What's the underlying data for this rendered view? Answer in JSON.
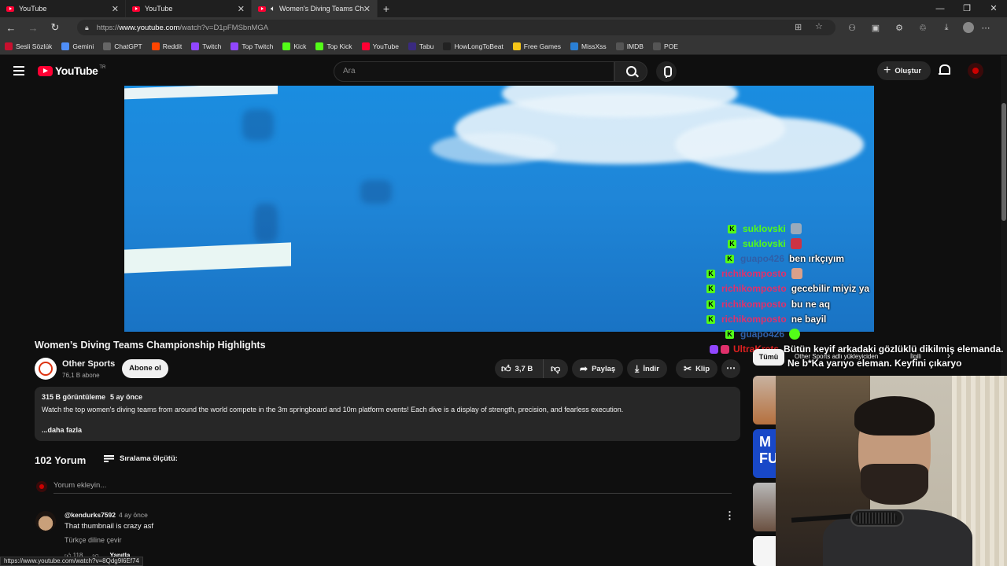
{
  "browser": {
    "tabs": [
      {
        "title": "YouTube",
        "active": false
      },
      {
        "title": "YouTube",
        "active": false
      },
      {
        "title": "Women's Diving Teams Cha",
        "active": true
      }
    ],
    "window_controls": {
      "minimize": "—",
      "maximize": "❐",
      "close": "✕"
    },
    "address": {
      "prefix": "https://",
      "host": "www.youtube.com",
      "path": "/watch?v=D1pFMSbnMGA"
    },
    "bookmarks": [
      {
        "label": "Sesli Sözlük",
        "color": "#c8102e"
      },
      {
        "label": "Gemini",
        "color": "#4f8ef7"
      },
      {
        "label": "ChatGPT",
        "color": "#666666"
      },
      {
        "label": "Reddit",
        "color": "#ff4500"
      },
      {
        "label": "Twitch",
        "color": "#9146ff"
      },
      {
        "label": "Top Twitch",
        "color": "#9146ff"
      },
      {
        "label": "Kick",
        "color": "#53fc18"
      },
      {
        "label": "Top Kick",
        "color": "#53fc18"
      },
      {
        "label": "YouTube",
        "color": "#ff0033"
      },
      {
        "label": "Tabu",
        "color": "#3a2a80"
      },
      {
        "label": "HowLongToBeat",
        "color": "#222222"
      },
      {
        "label": "Free Games",
        "color": "#f5c518"
      },
      {
        "label": "MissXss",
        "color": "#2a7fd4"
      },
      {
        "label": "IMDB",
        "color": "#555555"
      },
      {
        "label": "POE",
        "color": "#555555"
      }
    ],
    "status_url": "https://www.youtube.com/watch?v=8Qdg9l6Ef74"
  },
  "youtube": {
    "logo": "YouTube",
    "region": "TR",
    "search_placeholder": "Ara",
    "create_label": "Oluştur"
  },
  "video": {
    "title": "Women’s Diving Teams Championship Highlights",
    "channel": "Other Sports",
    "subscribers": "76,1 B abone",
    "subscribe_label": "Abone ol",
    "likes": "3,7 B",
    "share_label": "Paylaş",
    "download_label": "İndir",
    "clip_label": "Klip",
    "views": "315 B görüntüleme",
    "age": "5 ay önce",
    "description": "Watch the top women's diving teams from around the world compete in the 3m springboard and 10m platform events! Each dive is a display of strength, precision, and fearless execution.",
    "more_label": "...daha fazla"
  },
  "comments": {
    "count": "102 Yorum",
    "sort_label": "Sıralama ölçütü:",
    "add_placeholder": "Yorum ekleyin...",
    "items": [
      {
        "author": "@kendurks7592",
        "age": "4 ay önce",
        "text": "That thumbnail is crazy asf",
        "translate": "Türkçe diline çevir",
        "likes": "118",
        "reply_label": "Yanıtla"
      }
    ]
  },
  "sidebar": {
    "chips": [
      "Tümü",
      "Other Sports adlı yükleyiciden",
      "İlgili"
    ]
  },
  "chat_overlay": [
    {
      "user": "suklovski",
      "msg": "",
      "color": "#53fc18"
    },
    {
      "user": "suklovski",
      "msg": "",
      "color": "#53fc18"
    },
    {
      "user": "guapo426",
      "msg": "ben ırkçıyım",
      "color": "#2f5fa8"
    },
    {
      "user": "richikomposto",
      "msg": "",
      "color": "#e0306b"
    },
    {
      "user": "richikomposto",
      "msg": "gecebilir miyiz ya",
      "color": "#e0306b"
    },
    {
      "user": "richikomposto",
      "msg": "bu ne aq",
      "color": "#e0306b"
    },
    {
      "user": "richikomposto",
      "msg": "ne bayil",
      "color": "#e0306b"
    },
    {
      "user": "guapo426",
      "msg": "",
      "color": "#2f5fa8"
    },
    {
      "user": "UltraKrets",
      "msg": "Bütün keyif arkadaki gözlüklü dikilmiş elemanda.",
      "color": "#e02020"
    },
    {
      "user": "",
      "msg": "Ne b*Ka yarıyo eleman. Keyfini çıkaryo",
      "color": "#ffffff"
    }
  ],
  "colors": {
    "kick_green": "#53fc18",
    "yt_red": "#ff0033",
    "chip_bg": "#272727"
  }
}
